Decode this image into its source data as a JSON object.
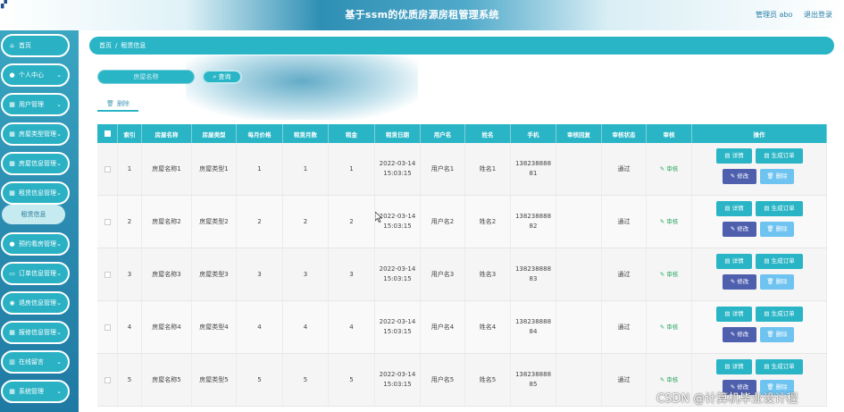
{
  "header": {
    "title": "基于ssm的优质房源房租管理系统",
    "admin_label": "管理员 abo",
    "logout_label": "退出登录"
  },
  "sidebar": {
    "items": [
      {
        "label": "首页",
        "icon": "home-icon",
        "glyph": "⌂",
        "has_arrow": false
      },
      {
        "label": "个人中心",
        "icon": "user-icon",
        "glyph": "●",
        "has_arrow": true
      },
      {
        "label": "用户管理",
        "icon": "grid-icon",
        "glyph": "▦",
        "has_arrow": true
      },
      {
        "label": "房屋类型管理",
        "icon": "grid-icon",
        "glyph": "▦",
        "has_arrow": true
      },
      {
        "label": "房屋信息管理",
        "icon": "grid-icon",
        "glyph": "▦",
        "has_arrow": true
      },
      {
        "label": "租赁信息管理",
        "icon": "grid-icon",
        "glyph": "▦",
        "has_arrow": true
      },
      {
        "label": "预约看房管理",
        "icon": "user-icon",
        "glyph": "●",
        "has_arrow": true
      },
      {
        "label": "订单信息管理",
        "icon": "monitor-icon",
        "glyph": "▭",
        "has_arrow": true
      },
      {
        "label": "退房信息管理",
        "icon": "coins-icon",
        "glyph": "◉",
        "has_arrow": true
      },
      {
        "label": "报修信息管理",
        "icon": "grid-icon",
        "glyph": "▦",
        "has_arrow": true
      },
      {
        "label": "在线留言",
        "icon": "trash-icon",
        "glyph": "▥",
        "has_arrow": true
      },
      {
        "label": "系统管理",
        "icon": "grid-icon",
        "glyph": "▦",
        "has_arrow": true
      }
    ],
    "active_sub": "租赁信息"
  },
  "breadcrumb": {
    "home": "首页",
    "separator": "/",
    "current": "租赁信息"
  },
  "search": {
    "placeholder": "房屋名称",
    "button_label": "查询",
    "button_icon": "search-icon"
  },
  "toolbar": {
    "delete_label": "删除",
    "delete_icon": "trash-icon"
  },
  "table": {
    "headers": [
      "索引",
      "房屋名称",
      "房屋类型",
      "每月价格",
      "租赁月数",
      "租金",
      "租赁日期",
      "用户名",
      "姓名",
      "手机",
      "审核回复",
      "审核状态",
      "审核",
      "操作"
    ],
    "rows": [
      {
        "index": "1",
        "house_name": "房屋名称1",
        "house_type": "房屋类型1",
        "monthly_price": "1",
        "months": "1",
        "rent": "1",
        "date": "2022-03-14",
        "time": "15:03:15",
        "username": "用户名1",
        "name": "姓名1",
        "phone_a": "138238888",
        "phone_b": "81",
        "reply": "",
        "status": "通过"
      },
      {
        "index": "2",
        "house_name": "房屋名称2",
        "house_type": "房屋类型2",
        "monthly_price": "2",
        "months": "2",
        "rent": "2",
        "date": "2022-03-14",
        "time": "15:03:15",
        "username": "用户名2",
        "name": "姓名2",
        "phone_a": "138238888",
        "phone_b": "82",
        "reply": "",
        "status": "通过"
      },
      {
        "index": "3",
        "house_name": "房屋名称3",
        "house_type": "房屋类型3",
        "monthly_price": "3",
        "months": "3",
        "rent": "3",
        "date": "2022-03-14",
        "time": "15:03:15",
        "username": "用户名3",
        "name": "姓名3",
        "phone_a": "138238888",
        "phone_b": "83",
        "reply": "",
        "status": "通过"
      },
      {
        "index": "4",
        "house_name": "房屋名称4",
        "house_type": "房屋类型4",
        "monthly_price": "4",
        "months": "4",
        "rent": "4",
        "date": "2022-03-14",
        "time": "15:03:15",
        "username": "用户名4",
        "name": "姓名4",
        "phone_a": "138238888",
        "phone_b": "84",
        "reply": "",
        "status": "通过"
      },
      {
        "index": "5",
        "house_name": "房屋名称5",
        "house_type": "房屋类型5",
        "monthly_price": "5",
        "months": "5",
        "rent": "5",
        "date": "2022-03-14",
        "time": "15:03:15",
        "username": "用户名5",
        "name": "姓名5",
        "phone_a": "138238888",
        "phone_b": "85",
        "reply": "",
        "status": "通过"
      }
    ],
    "audit_label": "审核",
    "actions": {
      "detail": "详情",
      "order": "生成订单",
      "edit": "修改",
      "delete": "删除"
    }
  },
  "watermark": "CSDN @计算机毕业设计程",
  "colors": {
    "accent": "#2ab5c6",
    "edit_button": "#4e5fae",
    "delete_button": "#6ec3f0",
    "sidebar": "#2b8bb0"
  }
}
